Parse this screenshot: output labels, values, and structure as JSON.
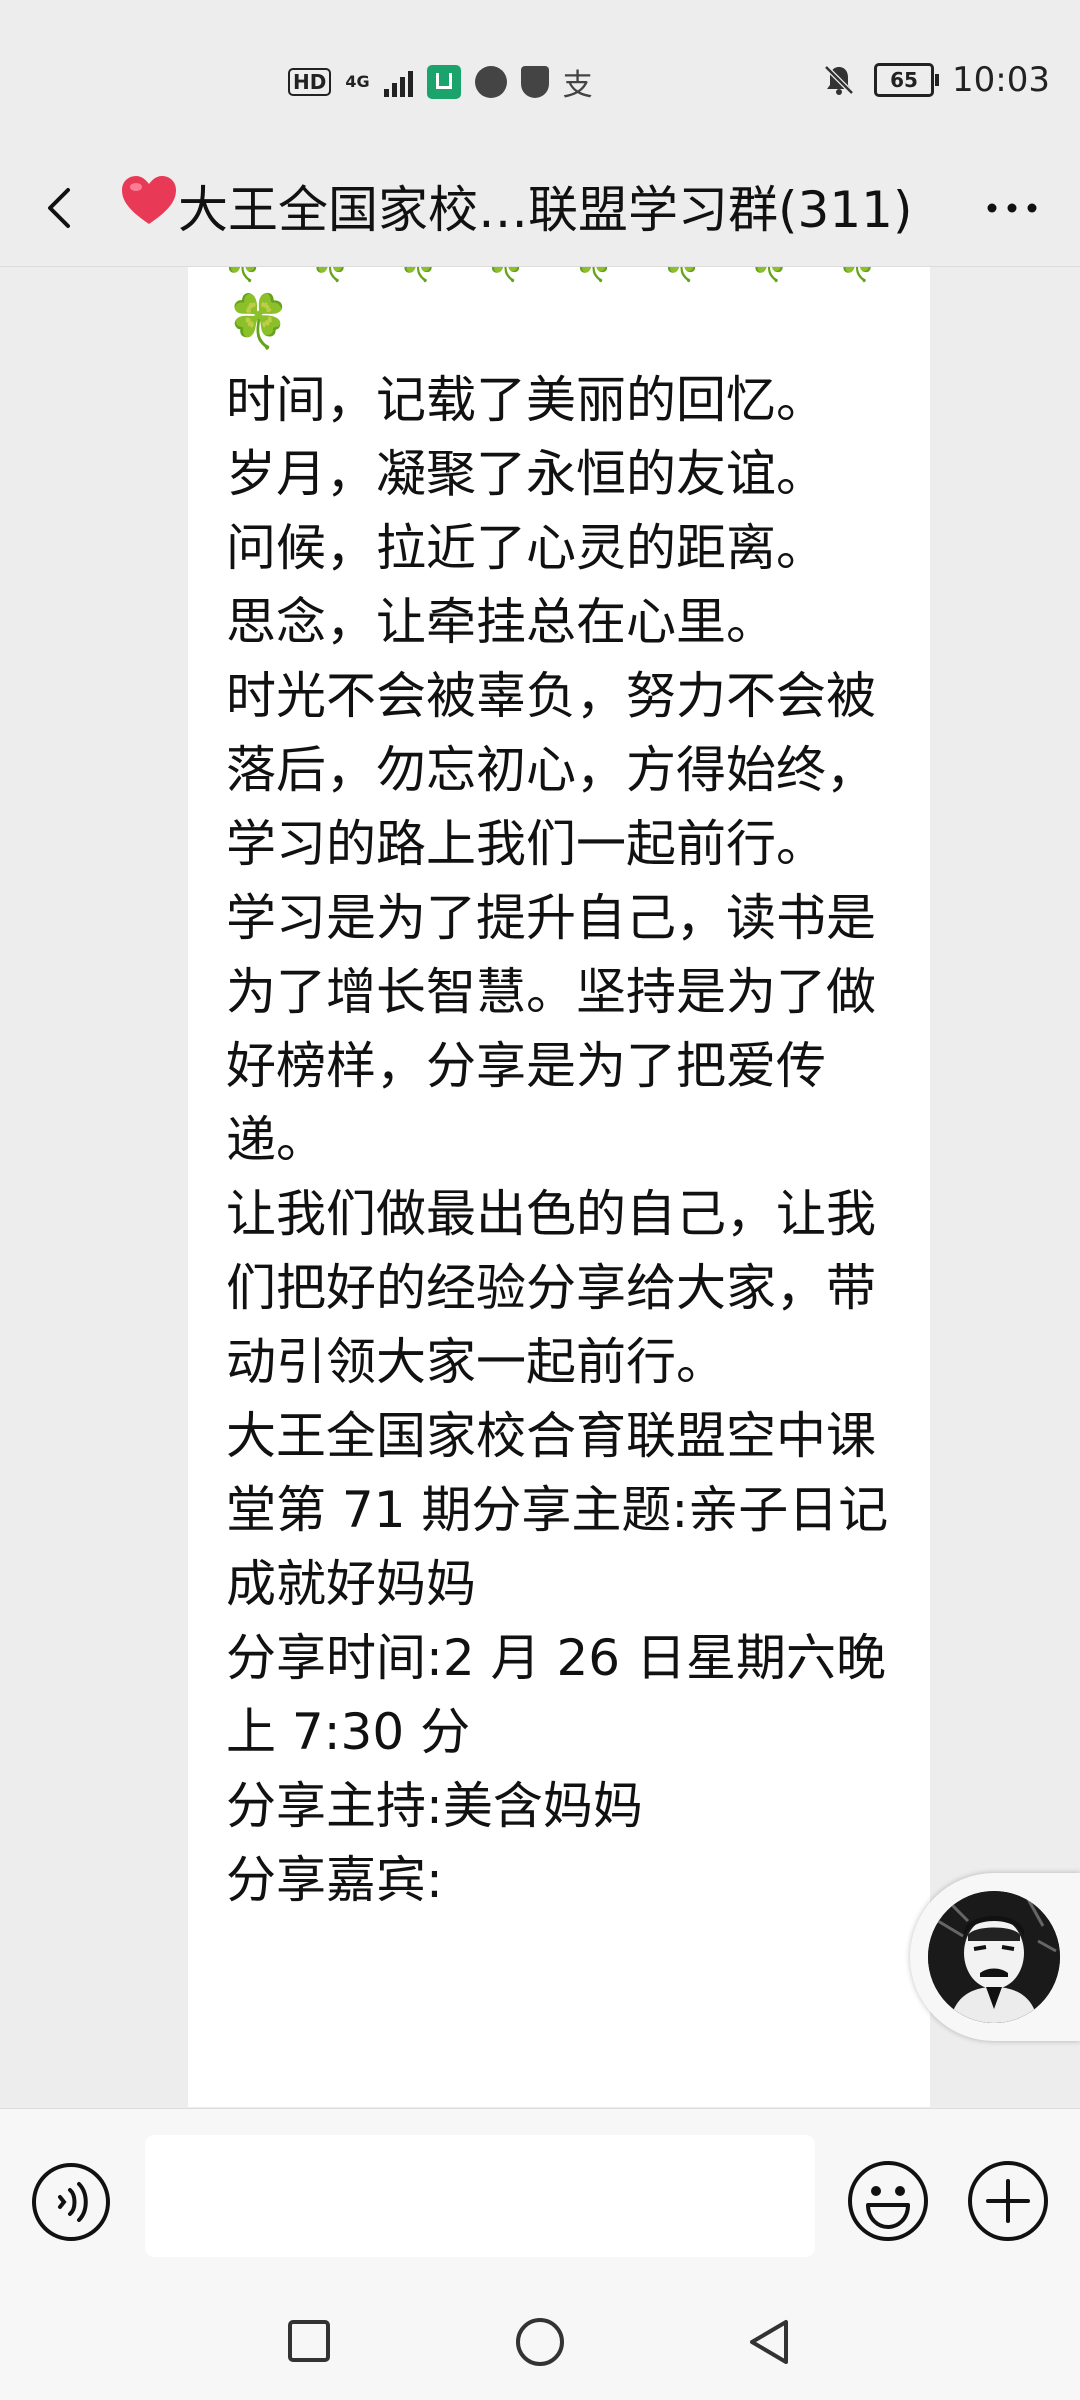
{
  "status_bar": {
    "hd": "HD",
    "network": "4G",
    "alipay_glyph": "支",
    "battery": "65",
    "time": "10:03",
    "icons": [
      "signal-icon",
      "app-icon",
      "browser-icon",
      "shield-icon",
      "alipay-icon",
      "mute-bell-icon",
      "battery-icon"
    ]
  },
  "header": {
    "title": "大王全国家校…联盟学习群(311)",
    "title_emoji": "heart-icon",
    "back_icon": "chevron-left-icon",
    "more_icon": "more-dots-icon"
  },
  "message": {
    "clover_row": "🍀🍀🍀🍀🍀🍀🍀🍀",
    "clover_single": "🍀",
    "paragraphs": [
      "时间，记载了美丽的回忆。",
      "岁月，凝聚了永恒的友谊。",
      "问候，拉近了心灵的距离。",
      "思念，让牵挂总在心里。",
      "时光不会被辜负，努力不会被落后，勿忘初心，方得始终，学习的路上我们一起前行。",
      "学习是为了提升自己，读书是为了增长智慧。坚持是为了做好榜样，分享是为了把爱传递。",
      "让我们做最出色的自己，让我们把好的经验分享给大家，带动引领大家一起前行。",
      "大王全国家校合育联盟空中课堂第 71 期分享主题:亲子日记成就好妈妈",
      "分享时间:2 月 26 日星期六晚上 7:30 分",
      "分享主持:美含妈妈",
      "分享嘉宾:"
    ]
  },
  "floating": {
    "avatar": "portrait-avatar"
  },
  "input_bar": {
    "placeholder": "",
    "voice_icon": "voice-icon",
    "emoji_icon": "emoji-icon",
    "plus_icon": "plus-icon"
  },
  "nav": {
    "icons": [
      "recent-apps-icon",
      "home-icon",
      "back-icon"
    ]
  }
}
